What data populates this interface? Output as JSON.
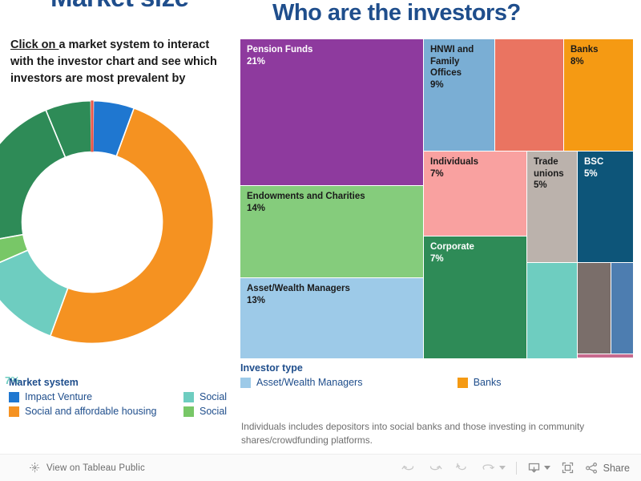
{
  "titles": {
    "left": "Market size",
    "right": "Who are the investors?"
  },
  "instruction": {
    "link_text": "Click on ",
    "rest": "a market system to interact with the investor chart and see which investors are most prevalent by"
  },
  "donut": {
    "legend_title": "Market system",
    "visible_pct_label": "7%",
    "pct_label_color": "#6ecdc0",
    "legend_items": [
      {
        "label": "Impact Venture",
        "color": "#1f77d0"
      },
      {
        "label": "Social and affordable housing",
        "color": "#f59221"
      },
      {
        "label": "Social",
        "color": "#6ecdc0"
      },
      {
        "label": "Social",
        "color": "#78c767"
      }
    ]
  },
  "chart_data": [
    {
      "type": "pie",
      "title": "Market size",
      "legend_position": "bottom",
      "categories": [
        "Impact Venture",
        "Social and affordable housing",
        "Social",
        "Social",
        "Social",
        "Social"
      ],
      "values": [
        9,
        47,
        7,
        4,
        19,
        13
      ],
      "colors": [
        "#1f77d0",
        "#f59221",
        "#6ecdc0",
        "#78c767",
        "#2e8b57",
        "#2e8b57"
      ],
      "labels": [
        "",
        "",
        "7%",
        "",
        "",
        ""
      ]
    },
    {
      "type": "treemap",
      "title": "Who are the investors?",
      "legend_title": "Investor type",
      "ylabel": "",
      "xlabel": "",
      "nodes": [
        {
          "label": "Pension Funds",
          "value": 21,
          "display": "21%",
          "color": "#8e3a9e",
          "text": "#ffffff"
        },
        {
          "label": "Endowments and Charities",
          "value": 14,
          "display": "14%",
          "color": "#85cc7c",
          "text": "#1a1a1a"
        },
        {
          "label": "Asset/Wealth Managers",
          "value": 13,
          "display": "13%",
          "color": "#9dcae8",
          "text": "#1a1a1a"
        },
        {
          "label": "HNWI and Family Offices",
          "value": 9,
          "display": "9%",
          "color": "#7aaed4",
          "text": "#1a1a1a"
        },
        {
          "label": "",
          "value": 9,
          "display": "",
          "color": "#ea7461",
          "text": "#1a1a1a"
        },
        {
          "label": "Banks",
          "value": 8,
          "display": "8%",
          "color": "#f59a13",
          "text": "#1a1a1a"
        },
        {
          "label": "Individuals",
          "value": 7,
          "display": "7%",
          "color": "#f9a1a0",
          "text": "#1a1a1a"
        },
        {
          "label": "Corporate",
          "value": 7,
          "display": "7%",
          "color": "#2e8b57",
          "text": "#ffffff"
        },
        {
          "label": "Trade unions",
          "value": 5,
          "display": "5%",
          "color": "#bbb2ac",
          "text": "#1a1a1a"
        },
        {
          "label": "BSC",
          "value": 5,
          "display": "5%",
          "color": "#0d5579",
          "text": "#ffffff"
        },
        {
          "label": "",
          "value": 3,
          "display": "",
          "color": "#6ecdc0",
          "text": "#1a1a1a"
        },
        {
          "label": "",
          "value": 2,
          "display": "",
          "color": "#7a6e6a",
          "text": "#ffffff"
        },
        {
          "label": "",
          "value": 1,
          "display": "",
          "color": "#4d7db0",
          "text": "#ffffff"
        },
        {
          "label": "",
          "value": 0.4,
          "display": "",
          "color": "#c76a8e",
          "text": "#ffffff"
        }
      ],
      "legend_items": [
        {
          "label": "Asset/Wealth Managers",
          "color": "#9dcae8"
        },
        {
          "label": "Banks",
          "color": "#f59a13"
        }
      ]
    }
  ],
  "treemap_legend": {
    "title": "Investor type",
    "items": [
      {
        "label": "Asset/Wealth Managers",
        "color": "#9dcae8"
      },
      {
        "label": "Banks",
        "color": "#f59a13"
      }
    ]
  },
  "footnote": "Individuals includes depositors into social banks and those investing in community shares/crowdfunding platforms.",
  "toolbar": {
    "view_label": "View on Tableau Public",
    "share_label": "Share",
    "icons": [
      "tableau-logo-icon",
      "undo-icon",
      "redo-icon",
      "revert-icon",
      "refresh-icon",
      "pause-caret-icon",
      "download-icon",
      "fullscreen-icon",
      "share-icon"
    ]
  },
  "colors": {
    "brand_blue": "#1f4e8c",
    "toolbar_bg": "#fafafa",
    "footnote_gray": "#6e6e6e"
  }
}
